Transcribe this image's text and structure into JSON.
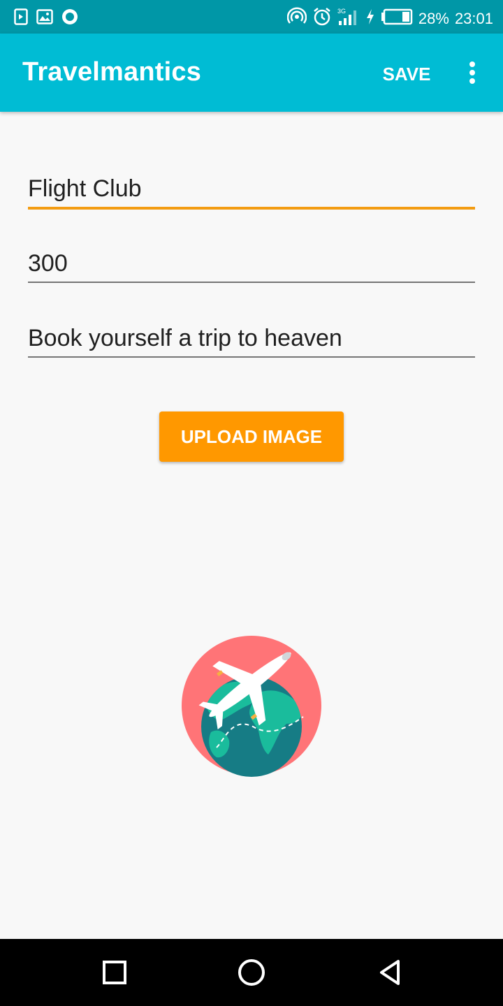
{
  "status_bar": {
    "battery_percent": "28%",
    "time": "23:01",
    "network": "3G",
    "icons": [
      "play-store-icon",
      "image-icon",
      "circle-notification-icon",
      "hotspot-icon",
      "alarm-icon",
      "signal-icon",
      "charging-icon",
      "battery-icon"
    ]
  },
  "app_bar": {
    "title": "Travelmantics",
    "save_label": "SAVE",
    "overflow_icon": "more-vert-icon",
    "color": "#00bcd4"
  },
  "form": {
    "title_value": "Flight Club",
    "price_value": "300",
    "description_value": "Book yourself a trip to heaven",
    "focused_underline_color": "#f39c12",
    "underline_color": "#757575"
  },
  "upload": {
    "label": "UPLOAD IMAGE",
    "color": "#ff9800"
  },
  "image": {
    "icon": "globe-airplane-icon"
  },
  "nav_bar": {
    "icons": [
      "recents-square-icon",
      "home-circle-icon",
      "back-triangle-icon"
    ]
  }
}
